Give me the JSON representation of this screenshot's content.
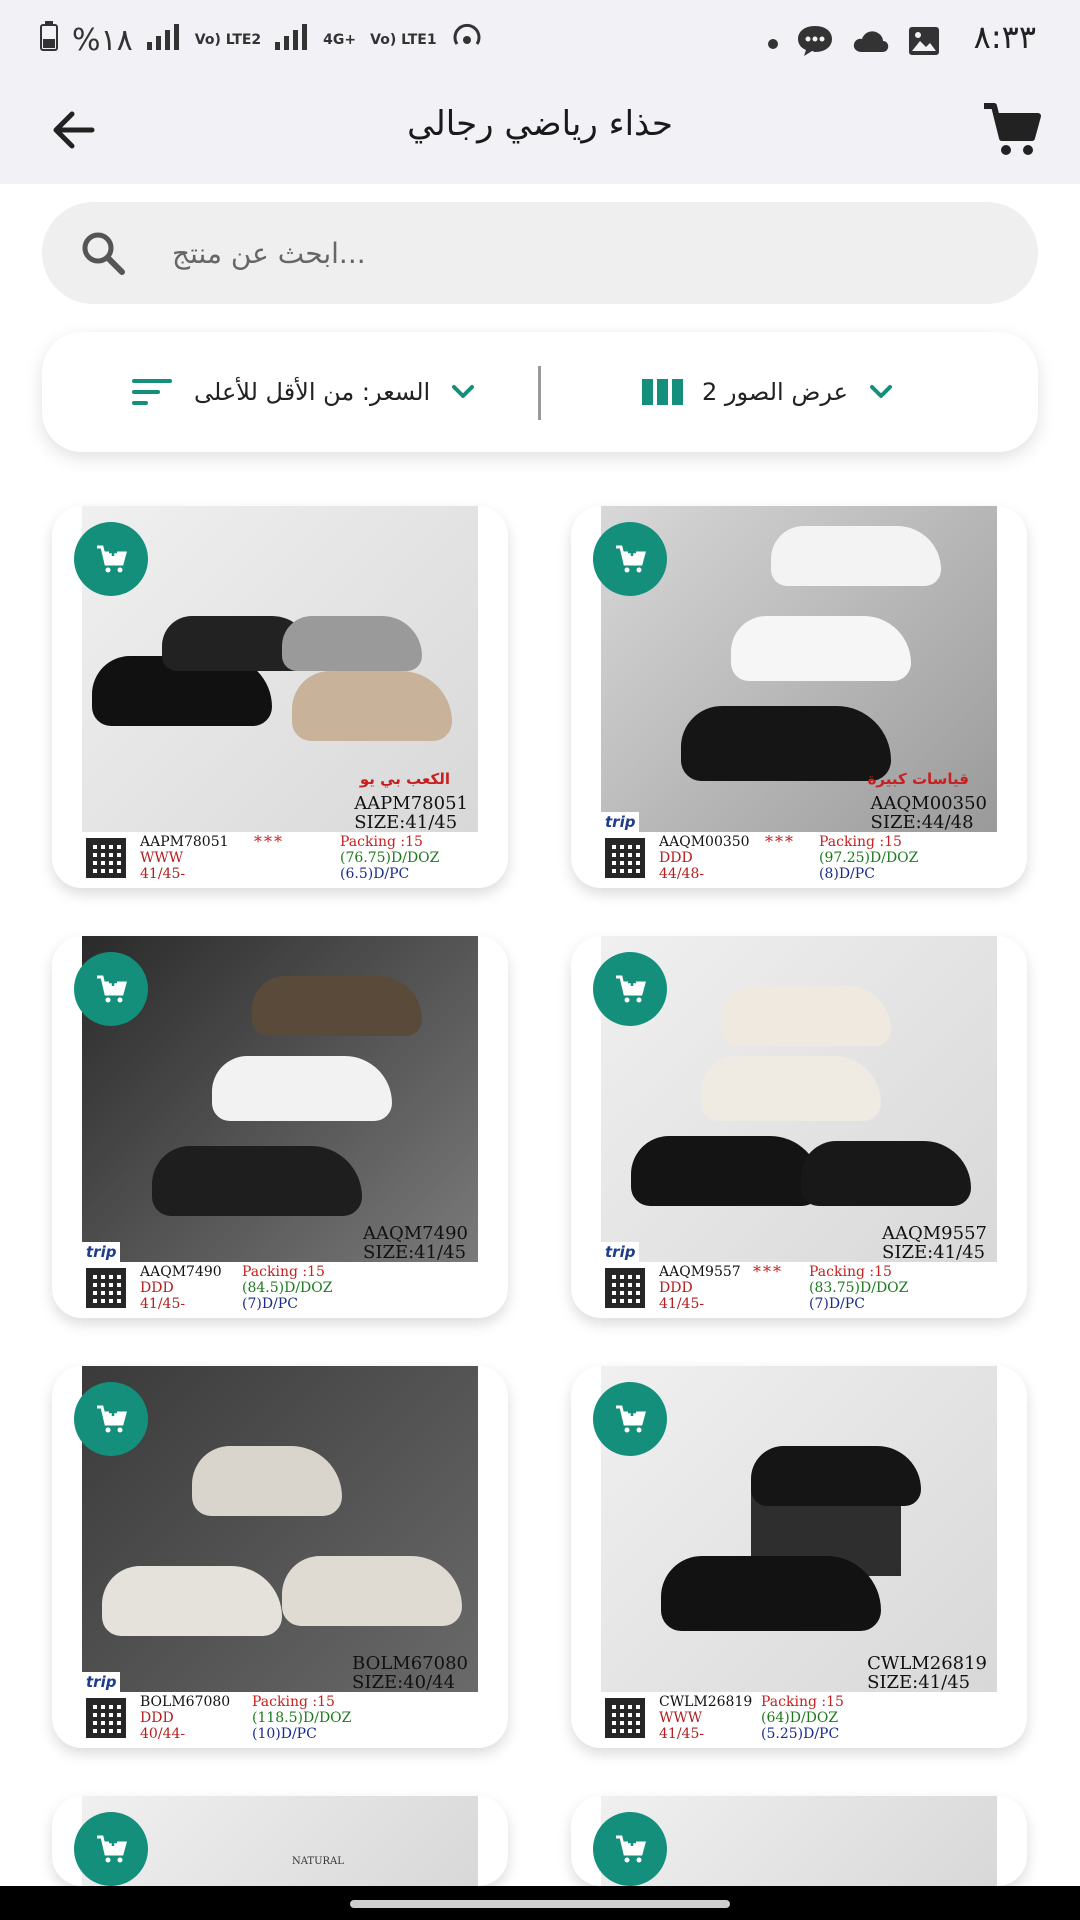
{
  "status_bar": {
    "time": "٨:٣٣",
    "battery": "%١٨",
    "net1": "Vo) LTE2",
    "net2": "4G+",
    "net3": "Vo) LTE1"
  },
  "header": {
    "title": "حذاء رياضي رجالي"
  },
  "search": {
    "placeholder": "...ابحث عن منتج"
  },
  "filters": {
    "sort_label": "السعر: من الأقل للأعلى",
    "view_label": "عرض الصور 2"
  },
  "products": [
    {
      "code": "AAPM78051",
      "size": "SIZE:41/45",
      "promo": "الكعب بي يو",
      "trip_logo": "",
      "grade": "WWW",
      "size_range": "41/45-",
      "stars": "***",
      "packing": "Packing :15",
      "doz": "(76.75)D/DOZ",
      "pc": "(6.5)D/PC"
    },
    {
      "code": "AAQM00350",
      "size": "SIZE:44/48",
      "promo": "قياسات كبيرة",
      "trip_logo": "trip",
      "grade": "DDD",
      "size_range": "44/48-",
      "stars": "***",
      "packing": "Packing :15",
      "doz": "(97.25)D/DOZ",
      "pc": "(8)D/PC"
    },
    {
      "code": "AAQM7490",
      "size": "SIZE:41/45",
      "promo": "",
      "trip_logo": "trip",
      "grade": "DDD",
      "size_range": "41/45-",
      "stars": "",
      "packing": "Packing :15",
      "doz": "(84.5)D/DOZ",
      "pc": "(7)D/PC"
    },
    {
      "code": "AAQM9557",
      "size": "SIZE:41/45",
      "promo": "",
      "trip_logo": "trip",
      "grade": "DDD",
      "size_range": "41/45-",
      "stars": "***",
      "packing": "Packing :15",
      "doz": "(83.75)D/DOZ",
      "pc": "(7)D/PC"
    },
    {
      "code": "BOLM67080",
      "size": "SIZE:40/44",
      "promo": "",
      "trip_logo": "trip",
      "grade": "DDD",
      "size_range": "40/44-",
      "stars": "",
      "packing": "Packing :15",
      "doz": "(118.5)D/DOZ",
      "pc": "(10)D/PC"
    },
    {
      "code": "CWLM26819",
      "size": "SIZE:41/45",
      "promo": "",
      "trip_logo": "",
      "grade": "WWW",
      "size_range": "41/45-",
      "stars": "",
      "packing": "Packing :15",
      "doz": "(64)D/DOZ",
      "pc": "(5.25)D/PC"
    }
  ],
  "partial_row_logo": "NATURAL",
  "colors": {
    "accent": "#138f7c",
    "header_bg": "#f2f1f6",
    "price_red": "#c62020",
    "doz_green": "#1c7a1c",
    "pc_blue": "#1a2a8c"
  }
}
